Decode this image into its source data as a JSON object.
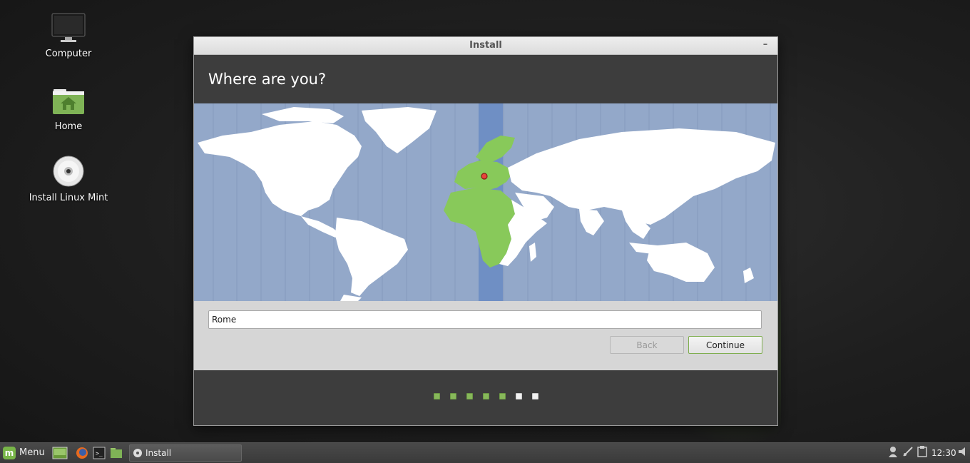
{
  "desktop": {
    "icons": [
      {
        "label": "Computer"
      },
      {
        "label": "Home"
      },
      {
        "label": "Install Linux Mint"
      }
    ]
  },
  "window": {
    "title": "Install",
    "minimize_glyph": "–",
    "heading": "Where are you?",
    "timezone_value": "Rome",
    "back_label": "Back",
    "continue_label": "Continue",
    "progress": {
      "total_steps": 7,
      "completed_steps": 5
    }
  },
  "map": {
    "highlight_color": "#88c95a",
    "ocean_color": "#93a8c9",
    "selected_band_color": "#6f8fc4",
    "marker_color": "#e8453c"
  },
  "taskbar": {
    "menu_label": "Menu",
    "task_label": "Install",
    "clock": "12:30",
    "launchers": [
      "show-desktop-icon",
      "firefox-icon",
      "terminal-icon",
      "files-icon"
    ],
    "tray_icons": [
      "user-icon",
      "network-icon",
      "clipboard-icon",
      "volume-icon"
    ]
  },
  "accent": "#78b548"
}
